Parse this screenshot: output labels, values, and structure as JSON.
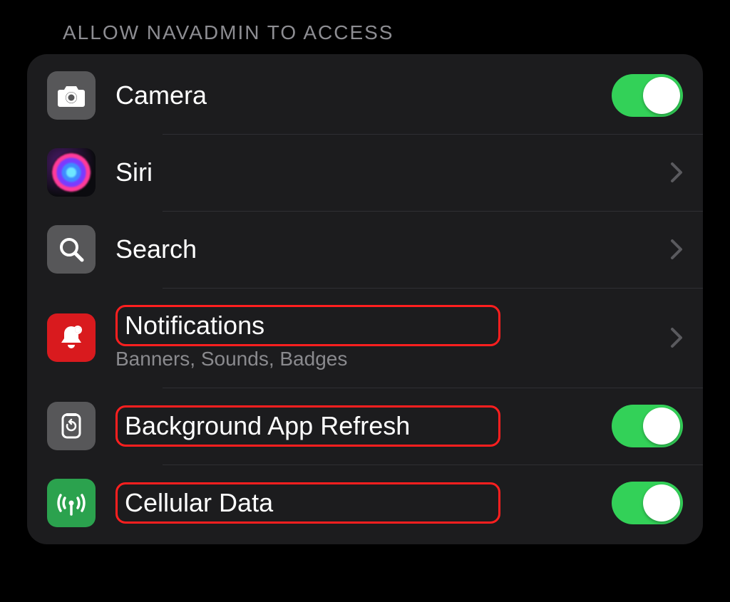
{
  "section_header": "ALLOW NAVADMIN TO ACCESS",
  "rows": {
    "camera": {
      "label": "Camera",
      "icon": "camera-icon",
      "toggle": true
    },
    "siri": {
      "label": "Siri",
      "icon": "siri-icon",
      "disclosure": true
    },
    "search": {
      "label": "Search",
      "icon": "search-icon",
      "disclosure": true
    },
    "notifications": {
      "label": "Notifications",
      "sublabel": "Banners, Sounds, Badges",
      "icon": "bell-icon",
      "disclosure": true,
      "highlighted": true
    },
    "background_refresh": {
      "label": "Background App Refresh",
      "icon": "refresh-icon",
      "toggle": true,
      "highlighted": true
    },
    "cellular_data": {
      "label": "Cellular Data",
      "icon": "cellular-icon",
      "toggle": true,
      "highlighted": true
    }
  }
}
